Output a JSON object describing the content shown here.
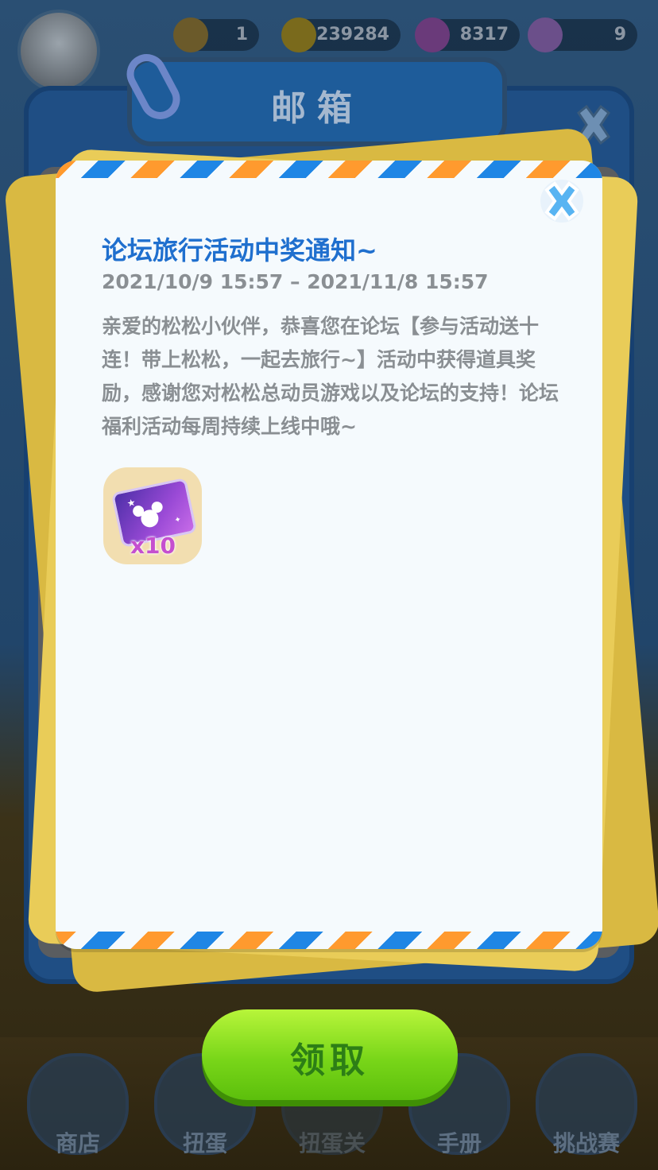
{
  "topbar": {
    "level": "1",
    "coins": "239284",
    "gems": "8317",
    "crowns": "9"
  },
  "mailbox": {
    "title": "邮箱"
  },
  "mail": {
    "title": "论坛旅行活动中奖通知~",
    "date_range": "2021/10/9  15:57 – 2021/11/8  15:57",
    "body": "亲爱的松松小伙伴，恭喜您在论坛【参与活动送十连！带上松松，一起去旅行~】活动中获得道具奖励，感谢您对松松总动员游戏以及论坛的支持！论坛福利活动每周持续上线中哦~",
    "reward": {
      "icon": "mickey-ticket-icon",
      "quantity": "x10"
    }
  },
  "claim_button": {
    "label": "领取"
  },
  "tabs": [
    "商店",
    "扭蛋",
    "扭蛋关",
    "手册",
    "挑战赛"
  ],
  "colors": {
    "title_blue": "#1f6fce",
    "stripe_blue": "#1f86e5",
    "stripe_orange": "#ff9a2e",
    "button_green": "#79d619"
  }
}
